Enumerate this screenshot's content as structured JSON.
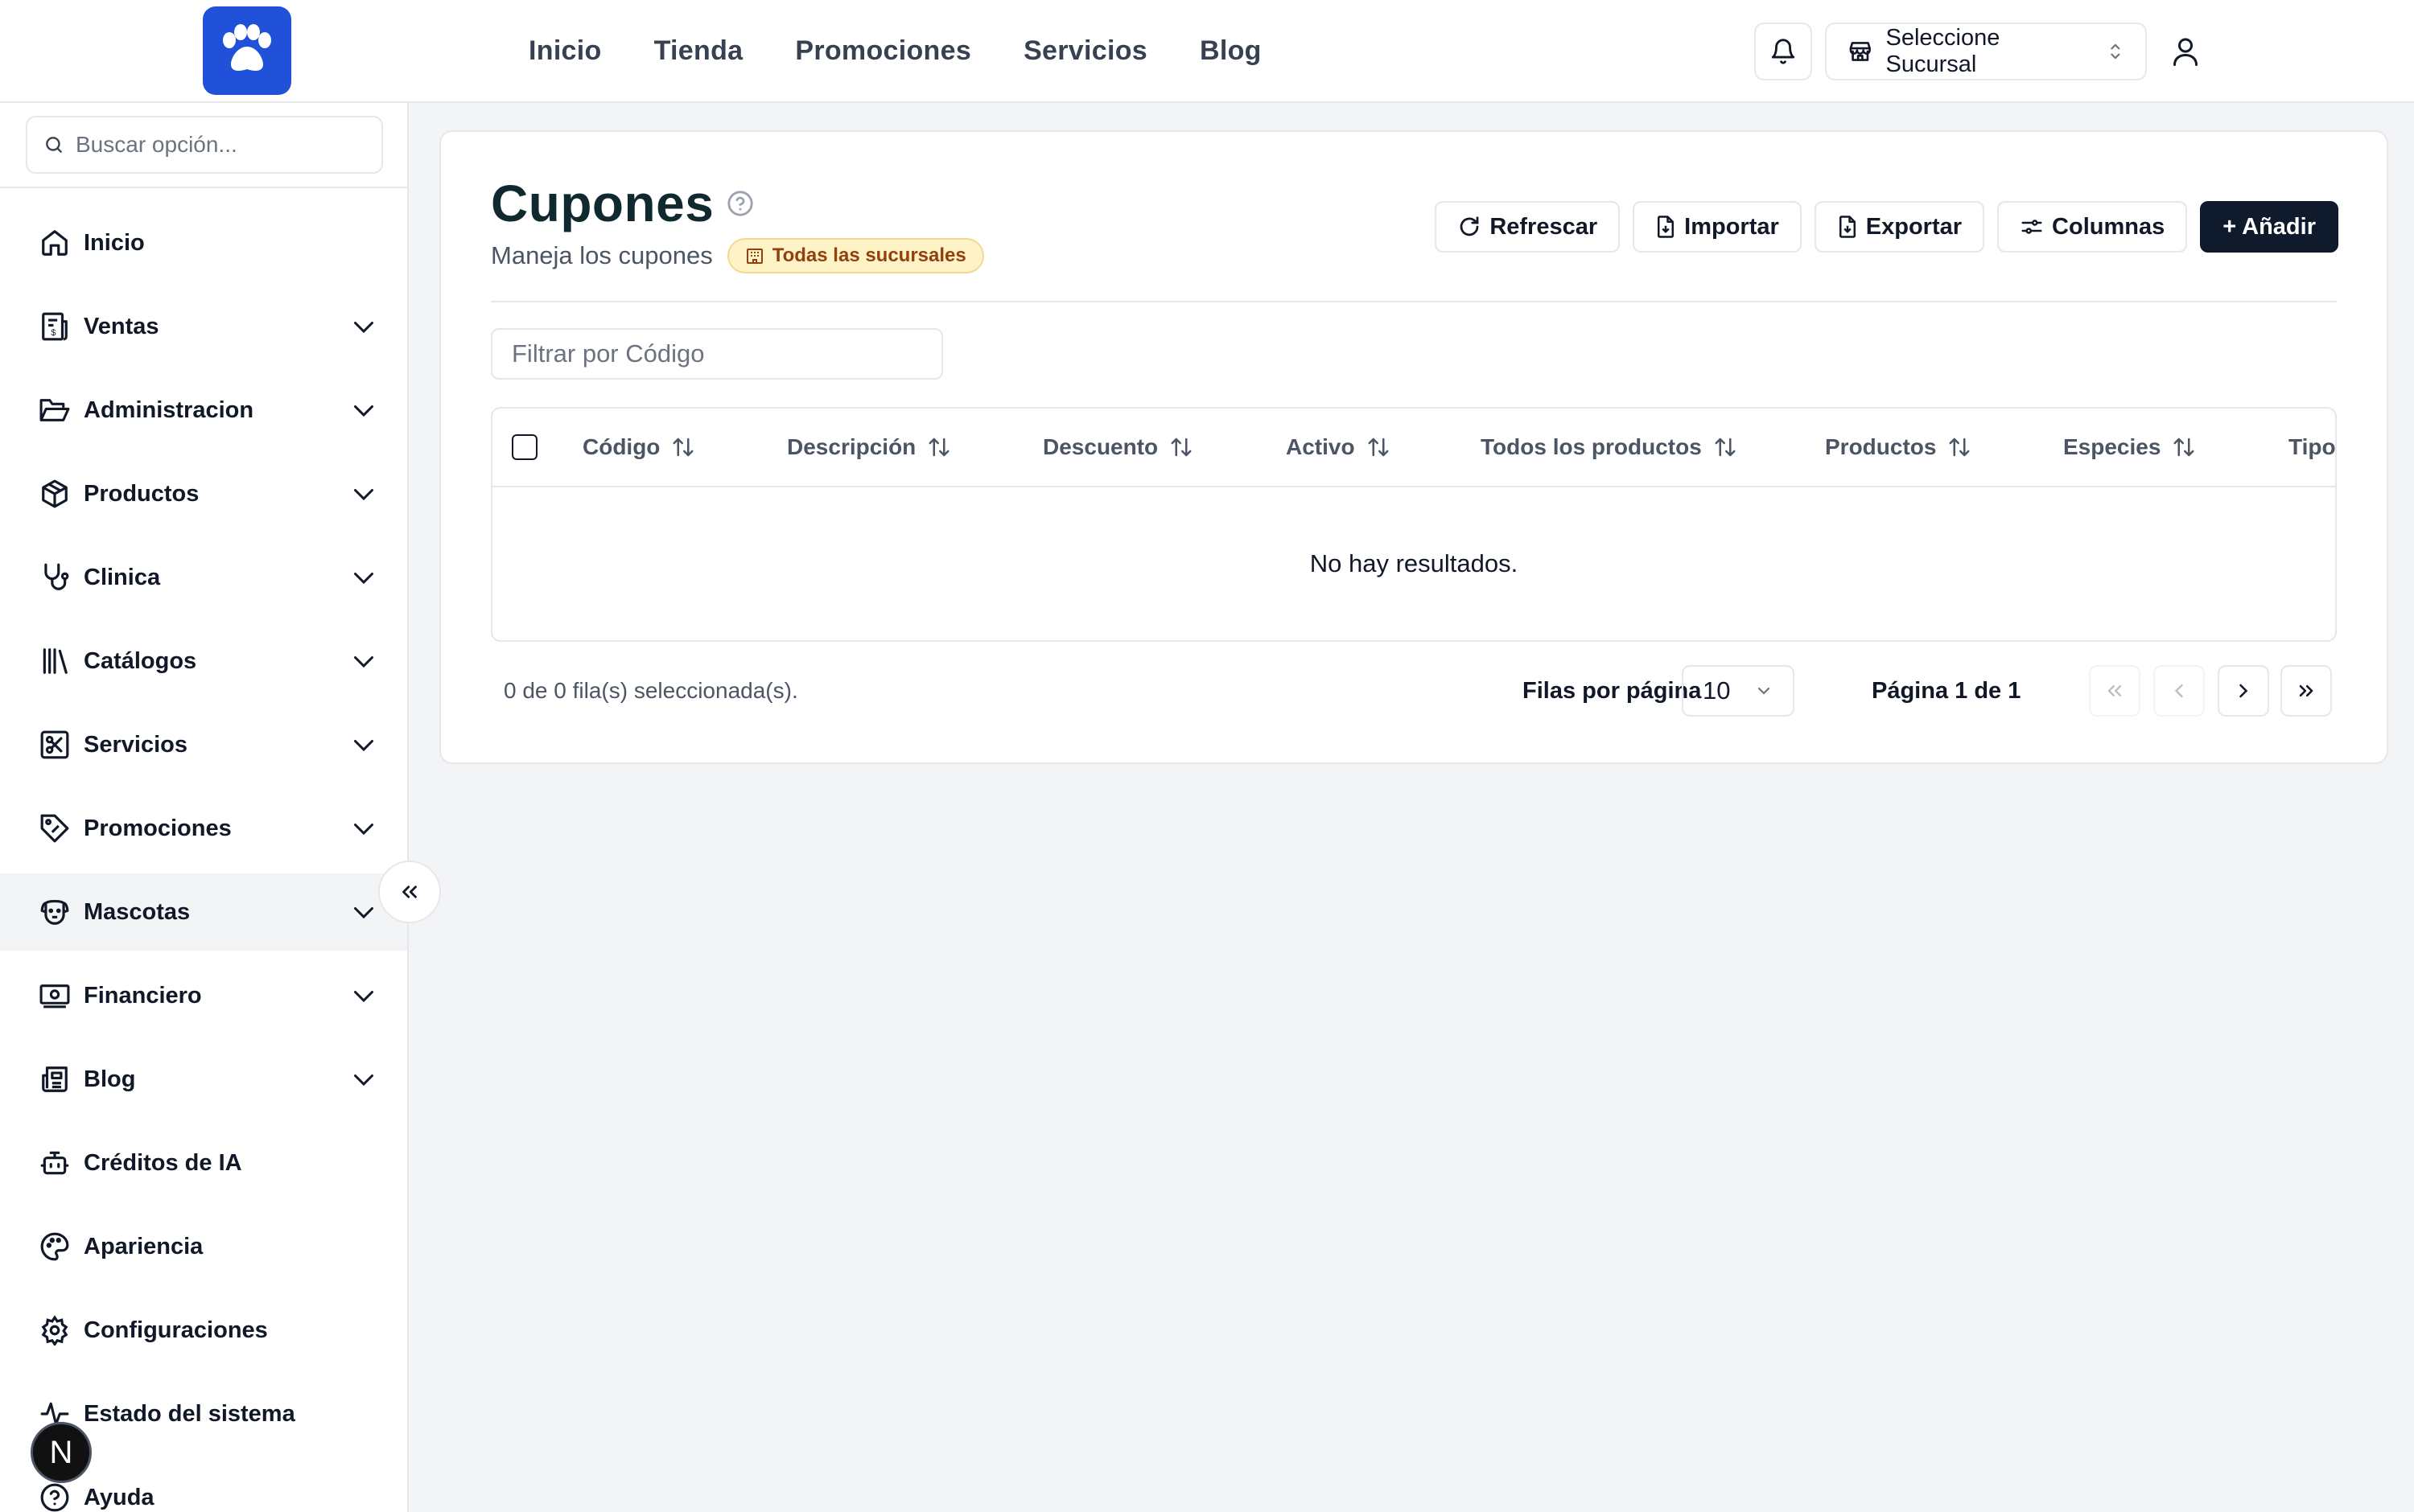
{
  "topnav": {
    "items": [
      "Inicio",
      "Tienda",
      "Promociones",
      "Servicios",
      "Blog"
    ],
    "branch_label": "Seleccione Sucursal"
  },
  "sidebar": {
    "search_placeholder": "Buscar opción...",
    "items": [
      {
        "label": "Inicio",
        "icon": "home-icon",
        "expandable": false
      },
      {
        "label": "Ventas",
        "icon": "receipt-icon",
        "expandable": true
      },
      {
        "label": "Administracion",
        "icon": "folder-open-icon",
        "expandable": true
      },
      {
        "label": "Productos",
        "icon": "package-icon",
        "expandable": true
      },
      {
        "label": "Clinica",
        "icon": "stethoscope-icon",
        "expandable": true
      },
      {
        "label": "Catálogos",
        "icon": "library-icon",
        "expandable": true
      },
      {
        "label": "Servicios",
        "icon": "scissors-square-icon",
        "expandable": true
      },
      {
        "label": "Promociones",
        "icon": "ticket-percent-icon",
        "expandable": true
      },
      {
        "label": "Mascotas",
        "icon": "dog-icon",
        "expandable": true,
        "active": true
      },
      {
        "label": "Financiero",
        "icon": "banknote-icon",
        "expandable": true
      },
      {
        "label": "Blog",
        "icon": "newspaper-icon",
        "expandable": true
      },
      {
        "label": "Créditos de IA",
        "icon": "bot-icon",
        "expandable": false
      },
      {
        "label": "Apariencia",
        "icon": "palette-icon",
        "expandable": false
      },
      {
        "label": "Configuraciones",
        "icon": "settings-icon",
        "expandable": false
      },
      {
        "label": "Estado del sistema",
        "icon": "activity-icon",
        "expandable": false
      },
      {
        "label": "Ayuda",
        "icon": "help-circle-icon",
        "expandable": false
      }
    ],
    "dev_badge": "N"
  },
  "page": {
    "title": "Cupones",
    "subtitle": "Maneja los cupones",
    "scope_badge": "Todas las sucursales"
  },
  "actions": {
    "refresh": "Refrescar",
    "import": "Importar",
    "export": "Exportar",
    "columns": "Columnas",
    "add": "+ Añadir"
  },
  "filter": {
    "placeholder": "Filtrar por Código"
  },
  "table": {
    "columns": [
      "Código",
      "Descripción",
      "Descuento",
      "Activo",
      "Todos los productos",
      "Productos",
      "Especies",
      "Tipo"
    ],
    "empty_text": "No hay resultados."
  },
  "pagination": {
    "selected_text": "0 de 0 fila(s) seleccionada(s).",
    "rows_label": "Filas por página",
    "rows_value": "10",
    "page_text": "Página 1 de 1"
  },
  "colors": {
    "brand": "#2151d8",
    "primary_button": "#0f1b2d",
    "title": "#10292f",
    "badge_bg": "#fdf3c7",
    "badge_text": "#92400e"
  }
}
